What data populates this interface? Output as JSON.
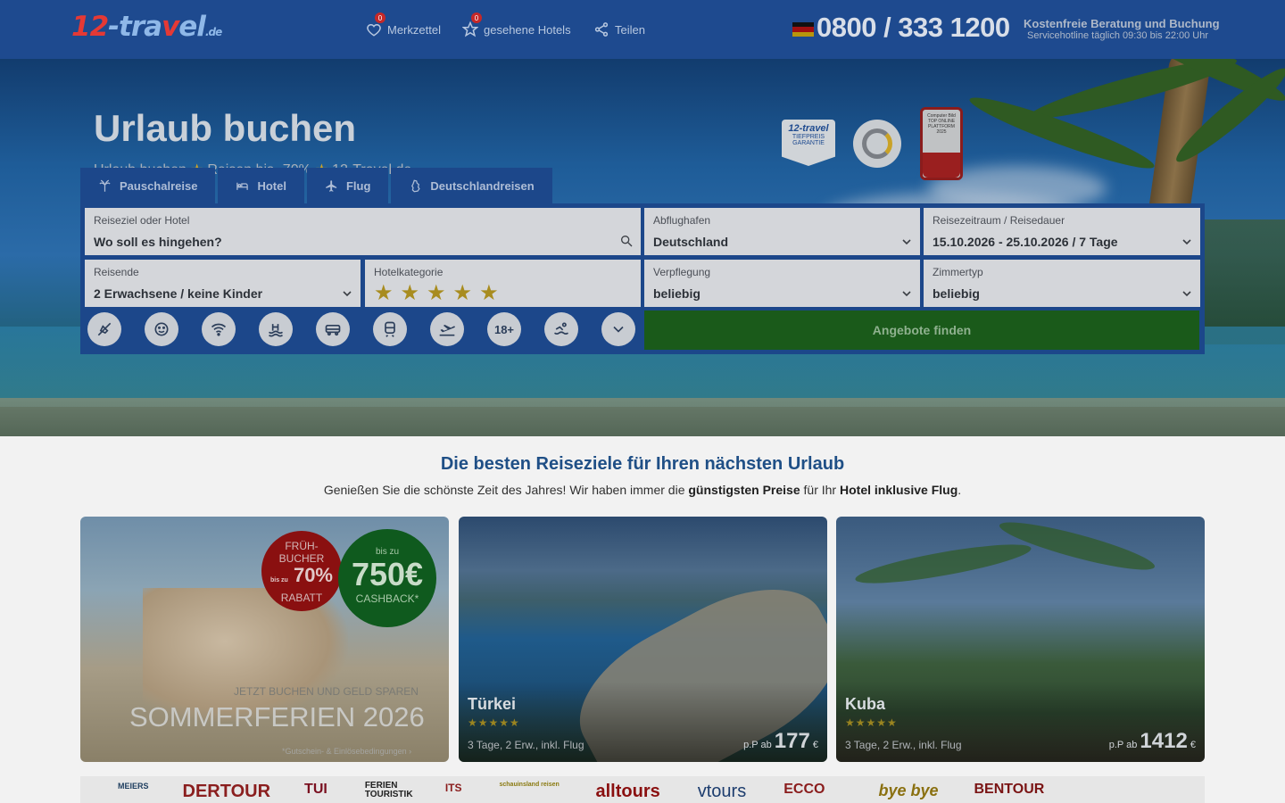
{
  "header": {
    "logo_parts": [
      "1",
      "2",
      "-tra",
      "v",
      "el",
      ".de"
    ],
    "nav": [
      {
        "label": "Merkzettel",
        "badge": "0",
        "icon": "heart-icon"
      },
      {
        "label": "gesehene Hotels",
        "badge": "0",
        "icon": "star-outline-icon"
      },
      {
        "label": "Teilen",
        "icon": "share-icon"
      }
    ],
    "phone": "0800 / 333 1200",
    "phone_title": "Kostenfreie Beratung und Buchung",
    "phone_hours": "Servicehotline täglich 09:30 bis 22:00 Uhr"
  },
  "hero": {
    "title": "Urlaub buchen",
    "subtitle_parts": [
      "Urlaub buchen",
      "Reisen bis -70%",
      "12-Travel.de"
    ],
    "badge1_brand": "12-travel",
    "badge1_text": "TIEFPREIS GARANTIE",
    "badge3_text": "Computer Bild TOP ONLINE PLATTFORM 2025"
  },
  "search": {
    "tabs": [
      {
        "label": "Pauschalreise",
        "icon": "palm-icon"
      },
      {
        "label": "Hotel",
        "icon": "bed-icon"
      },
      {
        "label": "Flug",
        "icon": "plane-icon"
      },
      {
        "label": "Deutschlandreisen",
        "icon": "germany-map-icon"
      }
    ],
    "destination_label": "Reiseziel oder Hotel",
    "destination_placeholder": "Wo soll es hingehen?",
    "airport_label": "Abflughafen",
    "airport_value": "Deutschland",
    "period_label": "Reisezeitraum / Reisedauer",
    "period_value": "15.10.2026 - 25.10.2026 / 7 Tage",
    "travelers_label": "Reisende",
    "travelers_value": "2 Erwachsene / keine Kinder",
    "category_label": "Hotelkategorie",
    "category_stars": 5,
    "meals_label": "Verpflegung",
    "meals_value": "beliebig",
    "room_label": "Zimmertyp",
    "room_value": "beliebig",
    "adults_only": "18+",
    "submit": "Angebote finden",
    "filters": [
      "no-pets-icon",
      "smiley-icon",
      "wifi-icon",
      "pool-icon",
      "bus-icon",
      "train-icon",
      "flight-icon",
      "adults-only-icon",
      "beach-icon",
      "more-icon"
    ]
  },
  "section": {
    "title": "Die besten Reiseziele für Ihren nächsten Urlaub",
    "sub_pre": "Genießen Sie die schönste Zeit des Jahres! Wir haben immer die ",
    "sub_b1": "günstigsten Preise",
    "sub_mid": " für Ihr ",
    "sub_b2": "Hotel inklusive Flug",
    "sub_post": "."
  },
  "promo": {
    "red1": "FRÜH-",
    "red2": "BUCHER",
    "red_prefix": "bis zu",
    "red_pct": "70%",
    "red3": "RABATT",
    "green_top": "bis zu",
    "green_big": "750€",
    "green_bottom": "CASHBACK*",
    "line1": "JETZT BUCHEN UND GELD SPAREN",
    "line2": "SOMMERFERIEN 2026",
    "line3": "*Gutschein- & Einlösebedingungen"
  },
  "cards": [
    {
      "name": "Türkei",
      "stars": "★★★★★",
      "info": "3 Tage, 2 Erw., inkl. Flug",
      "price_prefix": "p.P ab",
      "price": "177",
      "currency": "€"
    },
    {
      "name": "Kuba",
      "stars": "★★★★★",
      "info": "3 Tage, 2 Erw., inkl. Flug",
      "price_prefix": "p.P ab",
      "price": "1412",
      "currency": "€"
    }
  ],
  "brands": [
    {
      "name": "MEIERS",
      "color": "#1d3d5e"
    },
    {
      "name": "DERTOUR",
      "color": "#8a1e1e"
    },
    {
      "name": "TUI",
      "color": "#7a1020"
    },
    {
      "name": "FERIEN TOURISTIK",
      "color": "#202020"
    },
    {
      "name": "ITS",
      "color": "#8a1c1c"
    },
    {
      "name": "schauinsland reisen",
      "color": "#8a7a10"
    },
    {
      "name": "alltours",
      "color": "#8a1010"
    },
    {
      "name": "vtours",
      "color": "#1d3d6e"
    },
    {
      "name": "ECCO",
      "color": "#8a1c1c"
    },
    {
      "name": "bye bye",
      "color": "#8a7010"
    },
    {
      "name": "BENTOUR",
      "color": "#7a1414"
    }
  ]
}
